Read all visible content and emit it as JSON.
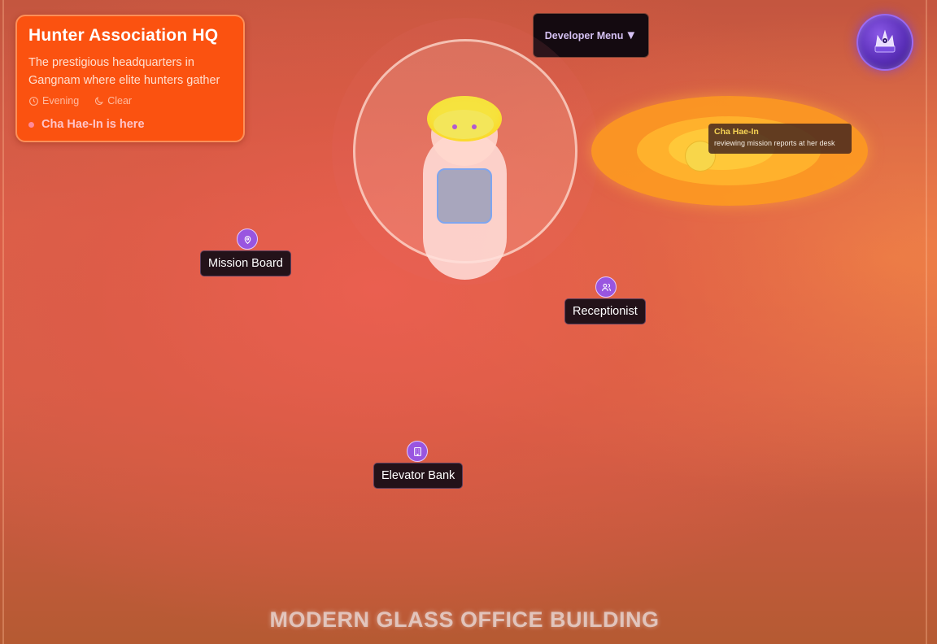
{
  "location": {
    "title": "Hunter Association HQ",
    "description": "The prestigious headquarters in Gangnam where elite hunters gather",
    "time_of_day": "Evening",
    "weather": "Clear",
    "presence": "Cha Hae-In is here",
    "time_icon": "clock-icon",
    "weather_icon": "moon-icon"
  },
  "dev_menu": {
    "label": "Developer Menu",
    "caret": "▼"
  },
  "crown_button": {
    "icon": "crown-icon",
    "color": "#6b3fd0"
  },
  "npc": {
    "name": "Cha Hae-In",
    "activity": "reviewing mission reports at her desk",
    "glow_color": "#ff9e1e"
  },
  "points_of_interest": [
    {
      "label": "Mission Board",
      "icon": "map-pin-icon"
    },
    {
      "label": "Receptionist",
      "icon": "users-icon"
    },
    {
      "label": "Elevator Bank",
      "icon": "building-icon"
    }
  ],
  "scene_title": "MODERN GLASS OFFICE BUILDING",
  "colors": {
    "card_bg": "#fb5210",
    "poi_icon_bg": "#9955e0",
    "label_bg": "#231219",
    "presence_text": "#ffc4c8"
  }
}
